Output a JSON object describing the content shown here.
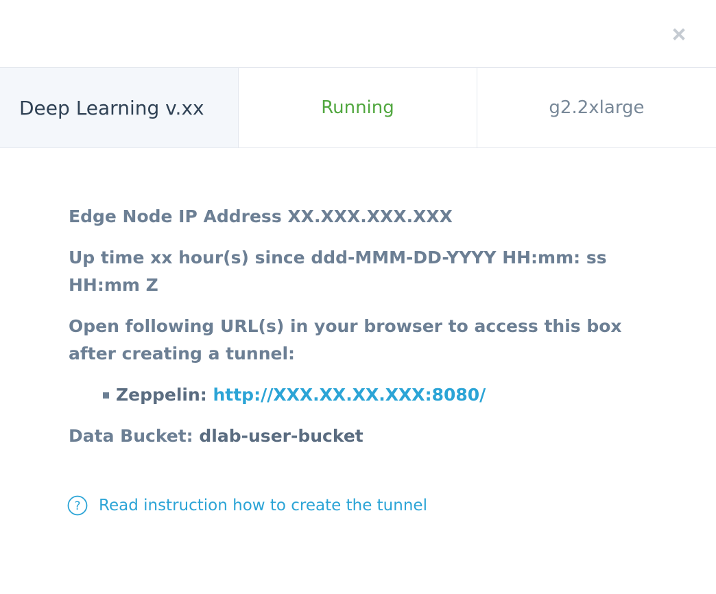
{
  "dialog": {
    "close_icon": "close-icon"
  },
  "header": {
    "name": "Deep Learning v.xx",
    "status": "Running",
    "shape": "g2.2xlarge",
    "status_color": "#51a73f"
  },
  "info": {
    "ip_line": "Edge Node IP Address XX.XXX.XXX.XXX",
    "uptime_line": "Up time xx hour(s) since ddd-MMM-DD-YYYY HH:mm: ss HH:mm Z",
    "urls_intro": "Open following URL(s) in your browser to access this box after creating a tunnel:",
    "urls": [
      {
        "label": "Zeppelin:",
        "url": "http://XXX.XX.XX.XXX:8080/"
      }
    ],
    "bucket_label": "Data Bucket:",
    "bucket_value": "dlab-user-bucket"
  },
  "help": {
    "icon": "question-circle-icon",
    "text": "Read instruction how to create the tunnel"
  },
  "colors": {
    "accent": "#2ba4d6",
    "text": "#6c7f94",
    "heading": "#2f4154"
  }
}
